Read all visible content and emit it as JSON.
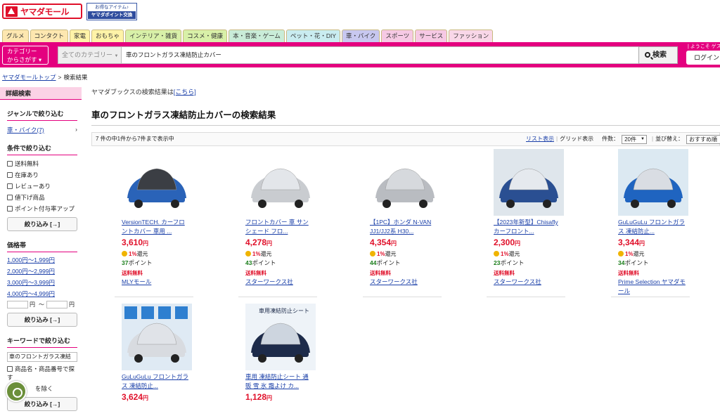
{
  "header": {
    "logo_text": "ヤマダモール",
    "points_line1": "お得なアイテム♪",
    "points_line2": "ヤマダポイント交換"
  },
  "nav_tabs": [
    {
      "label": "グルメ",
      "color": "#fde7b0"
    },
    {
      "label": "コンタクト",
      "color": "#fde7b0"
    },
    {
      "label": "家電",
      "color": "#fff3a8"
    },
    {
      "label": "おもちゃ",
      "color": "#fff3a8"
    },
    {
      "label": "インテリア・雑貨",
      "color": "#d8f0a8"
    },
    {
      "label": "コスメ・健康",
      "color": "#d8f0a8"
    },
    {
      "label": "本・音楽・ゲーム",
      "color": "#c9ecd8"
    },
    {
      "label": "ペット・花・DIY",
      "color": "#c9ecf0"
    },
    {
      "label": "車・バイク",
      "color": "#c8c8f0"
    },
    {
      "label": "スポーツ",
      "color": "#f6c9e4"
    },
    {
      "label": "サービス",
      "color": "#f6c9e4"
    },
    {
      "label": "ファッション",
      "color": "#f9d7e8"
    }
  ],
  "search": {
    "category_button": "カテゴリー\nからさがす ▾",
    "category_select": "全てのカテゴリー",
    "query": "車のフロントガラス凍結防止カバー",
    "button": "検索",
    "welcome": "| ようこそ ゲスト",
    "login": "ログイン・"
  },
  "breadcrumb": {
    "home": "ヤマダモールトップ",
    "separator": ">",
    "current": "検索結果"
  },
  "sidebar": {
    "header": "詳細検索",
    "genre_title": "ジャンルで絞り込む",
    "genre_item": "車・バイク(7)",
    "genre_arrow": "›",
    "condition_title": "条件で絞り込む",
    "conditions": [
      "送料無料",
      "在庫あり",
      "レビューあり",
      "値下げ商品",
      "ポイント付与率アップ"
    ],
    "refine_button": "絞り込み [→]",
    "price_title": "価格帯",
    "price_ranges": [
      "1,000円〜1,999円",
      "2,000円〜2,999円",
      "3,000円〜3,999円",
      "4,000円〜4,999円"
    ],
    "price_yen": "円",
    "price_tilde": "〜",
    "keyword_title": "キーワードで絞り込む",
    "keyword_value": "車のフロントガラス凍結",
    "keyword_option": "商品名・商品番号で探す",
    "keyword_exclude": "を除く"
  },
  "main": {
    "alt_text": "ヤマダブックスの検索結果は",
    "alt_link": "[こちら]",
    "title": "車のフロントガラス凍結防止カバーの検索結果",
    "count_text": "7 件の中1件から7件まで表示中",
    "list_view": "リスト表示",
    "divider": "|",
    "grid_view": "グリッド表示",
    "per_page_label": "件数：",
    "per_page_value": "20件",
    "sort_label": "並び替え：",
    "sort_value": "おすすめ順"
  },
  "products": [
    {
      "name": "VersionTECH. カーフロントカバー 車用 ...",
      "price": "3,610",
      "yen": "円",
      "rate": "1%",
      "rate_suffix": "還元",
      "points": "37",
      "points_suffix": "ポイント",
      "shipping": "送料無料",
      "shop": "MLYモール"
    },
    {
      "name": "フロントカバー 車 サンシェード フロ...",
      "price": "4,278",
      "yen": "円",
      "rate": "1%",
      "rate_suffix": "還元",
      "points": "43",
      "points_suffix": "ポイント",
      "shipping": "送料無料",
      "shop": "スターワークス社"
    },
    {
      "name": "【1PC】ホンダ N-VAN JJ1/JJ2系 H30...",
      "price": "4,354",
      "yen": "円",
      "rate": "1%",
      "rate_suffix": "還元",
      "points": "44",
      "points_suffix": "ポイント",
      "shipping": "送料無料",
      "shop": "スターワークス社"
    },
    {
      "name": "【2023年新型】Chisafly カーフロント...",
      "price": "2,300",
      "yen": "円",
      "rate": "1%",
      "rate_suffix": "還元",
      "points": "23",
      "points_suffix": "ポイント",
      "shipping": "送料無料",
      "shop": "スターワークス社"
    },
    {
      "name": "GuLuGuLu フロントガラス 凍結防止...",
      "price": "3,344",
      "yen": "円",
      "rate": "1%",
      "rate_suffix": "還元",
      "points": "34",
      "points_suffix": "ポイント",
      "shipping": "送料無料",
      "shop": "Prime Selection ヤマダモール"
    },
    {
      "name": "GuLuGuLu フロントガラス 凍結防止...",
      "price": "3,624",
      "yen": "円",
      "rate": "",
      "rate_suffix": "",
      "points": "",
      "points_suffix": "",
      "shipping": "",
      "shop": ""
    },
    {
      "name": "車用 凍結防止シート 通販 雪 氷 霜よけ カ...",
      "price": "1,128",
      "yen": "円",
      "rate": "",
      "rate_suffix": "",
      "points": "",
      "points_suffix": "",
      "shipping": "",
      "shop": "",
      "image_label": "車用凍結防止シート"
    }
  ]
}
